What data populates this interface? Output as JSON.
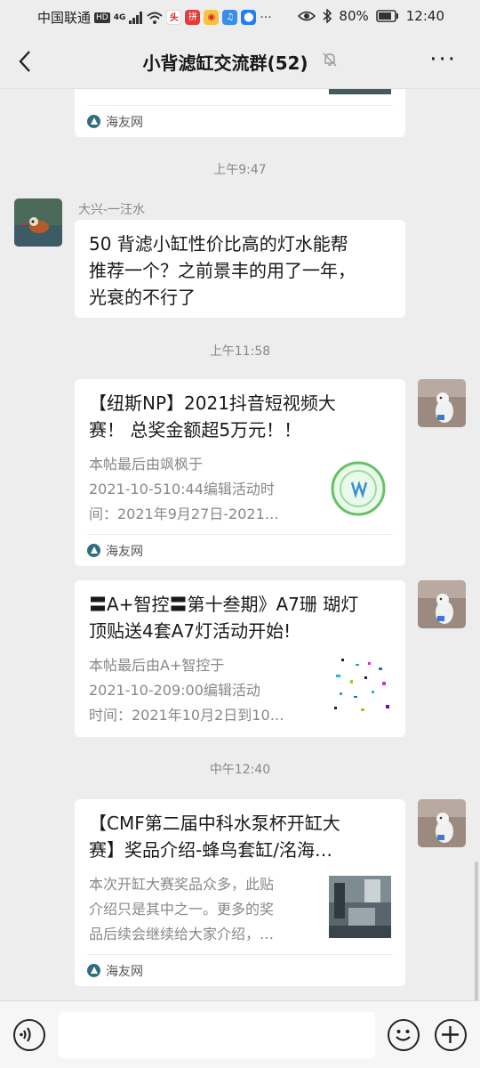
{
  "status": {
    "carrier": "中国联通",
    "hd": "HD",
    "network": "4G",
    "battery": "80%",
    "time": "12:40"
  },
  "header": {
    "title": "小背滤缸交流群(52)",
    "mute_icon": "bell-off-icon",
    "more_icon": "more-icon",
    "back_icon": "back-icon"
  },
  "messages": [
    {
      "type": "link_partial",
      "source": "海友网"
    },
    {
      "type": "time",
      "text": "上午9:47"
    },
    {
      "type": "text",
      "sender": "大兴-一汪水",
      "text_lines": [
        "50 背滤小缸性价比高的灯水能帮",
        "推荐一个？之前景丰的用了一年，",
        "光衰的不行了"
      ]
    },
    {
      "type": "time",
      "text": "上午11:58"
    },
    {
      "type": "link",
      "title_lines": [
        "【纽斯NP】2021抖音短视频大",
        "赛！ 总奖金额超5万元！！"
      ],
      "desc_lines": [
        "本帖最后由飒枫于",
        "2021-10-510:44编辑活动时",
        "间：2021年9月27日-2021…"
      ],
      "source": "海友网"
    },
    {
      "type": "link",
      "title_lines": [
        "〓A+智控〓第十叁期》A7珊 瑚灯",
        "顶贴送4套A7灯活动开始!"
      ],
      "desc_lines": [
        "本帖最后由A+智控于",
        "2021-10-209:00编辑活动",
        "时间：2021年10月2日到10…"
      ]
    },
    {
      "type": "time",
      "text": "中午12:40"
    },
    {
      "type": "link",
      "title_lines": [
        "【CMF第二届中科水泵杯开缸大",
        "赛】奖品介绍-蜂鸟套缸/洺海…"
      ],
      "desc_lines": [
        "本次开缸大赛奖品众多，此贴",
        "介绍只是其中之一。更多的奖",
        "品后续会继续给大家介绍，…"
      ],
      "source": "海友网"
    }
  ],
  "input_bar": {
    "voice_icon": "voice-icon",
    "emoji_icon": "emoji-icon",
    "plus_icon": "plus-icon"
  }
}
